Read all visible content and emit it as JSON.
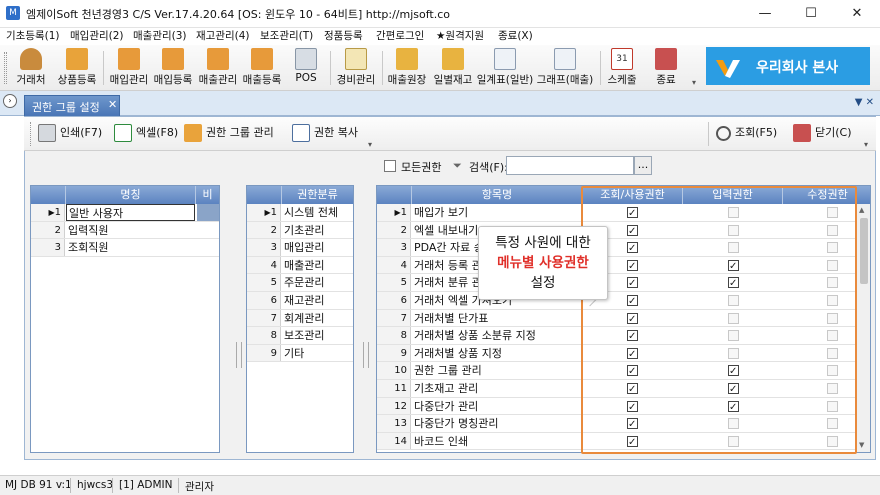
{
  "window": {
    "title": "엠제이Soft 천년경영3 C/S  Ver.17.4.20.64  [OS: 윈도우 10 - 64비트]  http://mjsoft.co",
    "controls": [
      "—",
      "☐",
      "✕"
    ]
  },
  "menu": [
    "기초등록(1)",
    "매입관리(2)",
    "매출관리(3)",
    "재고관리(4)",
    "보조관리(T)",
    "정품등록",
    "간편로그인",
    "★원격지원",
    "종료(X)"
  ],
  "toolbar": [
    "거래처",
    "상품등록",
    "매입관리",
    "매입등록",
    "매출관리",
    "매출등록",
    "POS",
    "경비관리",
    "매출원장",
    "일별재고",
    "일계표(일반)",
    "그래프(매출)",
    "스케줄",
    "종료"
  ],
  "brand": {
    "name": "우리회사 본사",
    "color": "#2b9de3"
  },
  "tab": {
    "label": "권한 그룹 설정",
    "close": "✕"
  },
  "inner_toolbar": {
    "print": "인쇄(F7)",
    "excel": "엑셀(F8)",
    "group": "권한 그룹 관리",
    "copy": "권한 복사",
    "search": "조회(F5)",
    "close": "닫기(C)"
  },
  "filter": {
    "all_label": "모든권한",
    "search_label": "검색(F):",
    "search_value": "",
    "browse": "..."
  },
  "grid1": {
    "headers": [
      "명칭",
      "비"
    ],
    "rows": [
      {
        "num": "1",
        "name": "일반 사용자"
      },
      {
        "num": "2",
        "name": "입력직원"
      },
      {
        "num": "3",
        "name": "조회직원"
      }
    ]
  },
  "grid2": {
    "headers": [
      "권한분류"
    ],
    "rows": [
      {
        "num": "1",
        "name": "시스템 전체"
      },
      {
        "num": "2",
        "name": "기초관리"
      },
      {
        "num": "3",
        "name": "매입관리"
      },
      {
        "num": "4",
        "name": "매출관리"
      },
      {
        "num": "5",
        "name": "주문관리"
      },
      {
        "num": "6",
        "name": "재고관리"
      },
      {
        "num": "7",
        "name": "회계관리"
      },
      {
        "num": "8",
        "name": "보조관리"
      },
      {
        "num": "9",
        "name": "기타"
      }
    ]
  },
  "grid3": {
    "headers": [
      "항목명",
      "조회/사용권한",
      "입력권한",
      "수정권한"
    ],
    "rows": [
      {
        "num": "1",
        "name": "매입가 보기",
        "view": true,
        "input": false,
        "edit": false
      },
      {
        "num": "2",
        "name": "엑셀 내보내기",
        "view": true,
        "input": false,
        "edit": false
      },
      {
        "num": "3",
        "name": "PDA간 자료 송",
        "view": true,
        "input": false,
        "edit": false
      },
      {
        "num": "4",
        "name": "거래처 등록 관",
        "view": true,
        "input": true,
        "edit": false
      },
      {
        "num": "5",
        "name": "거래처 분류 관",
        "view": true,
        "input": true,
        "edit": false
      },
      {
        "num": "6",
        "name": "거래처 엑셀 가져오기",
        "view": true,
        "input": false,
        "edit": false
      },
      {
        "num": "7",
        "name": "거래처별 단가표",
        "view": true,
        "input": false,
        "edit": false
      },
      {
        "num": "8",
        "name": "거래처별 상품 소분류 지정",
        "view": true,
        "input": false,
        "edit": false
      },
      {
        "num": "9",
        "name": "거래처별 상품 지정",
        "view": true,
        "input": false,
        "edit": false
      },
      {
        "num": "10",
        "name": "권한 그룹 관리",
        "view": true,
        "input": true,
        "edit": false
      },
      {
        "num": "11",
        "name": "기초재고 관리",
        "view": true,
        "input": true,
        "edit": false
      },
      {
        "num": "12",
        "name": "다중단가 관리",
        "view": true,
        "input": true,
        "edit": false
      },
      {
        "num": "13",
        "name": "다중단가 명칭관리",
        "view": true,
        "input": false,
        "edit": false
      },
      {
        "num": "14",
        "name": "바코드 인쇄",
        "view": true,
        "input": false,
        "edit": false
      }
    ]
  },
  "callout": {
    "line1": "특정 사원에 대한",
    "line2": "메뉴별 사용권한",
    "line3": "설정",
    "accent": "#e0302a"
  },
  "status": [
    "MJ DB 91 v:1",
    "hjwcs3",
    "[1] ADMIN",
    "관리자"
  ]
}
